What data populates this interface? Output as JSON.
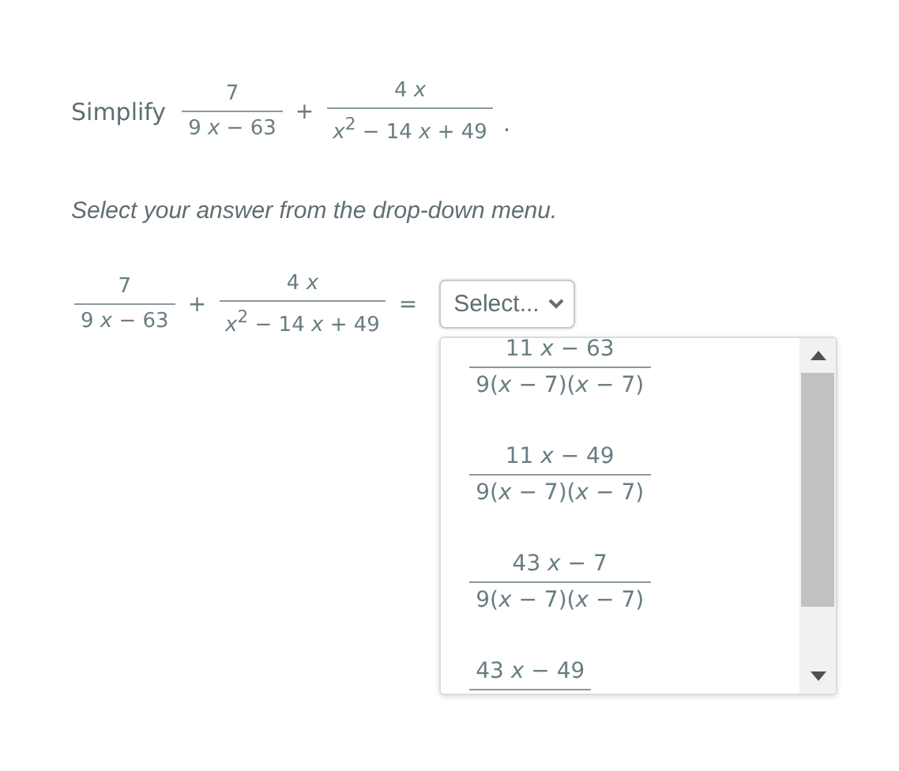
{
  "prompt": {
    "label": "Simplify",
    "operator": "+",
    "end": ".",
    "terms": [
      {
        "numerator": "7",
        "denominator": "9 *x* − 63"
      },
      {
        "numerator": "4 *x*",
        "denominator": "*x*$^{2}$ − 14 *x* + 49"
      }
    ]
  },
  "instruction": "Select your answer from the drop-down menu.",
  "equation": {
    "operator": "+",
    "equals": "=",
    "terms": [
      {
        "numerator": "7",
        "denominator": "9 *x* − 63"
      },
      {
        "numerator": "4 *x*",
        "denominator": "*x*$^{2}$ − 14 *x* + 49"
      }
    ]
  },
  "dropdown": {
    "placeholder": "Select...",
    "expanded": true,
    "options": [
      {
        "numerator": "11 *x* − 63",
        "denominator": "9(*x* − 7)(*x* − 7)"
      },
      {
        "numerator": "11 *x* − 49",
        "denominator": "9(*x* − 7)(*x* − 7)"
      },
      {
        "numerator": "43 *x* − 7",
        "denominator": "9(*x* − 7)(*x* − 7)"
      },
      {
        "numerator": "43 *x* − 49"
      }
    ]
  }
}
